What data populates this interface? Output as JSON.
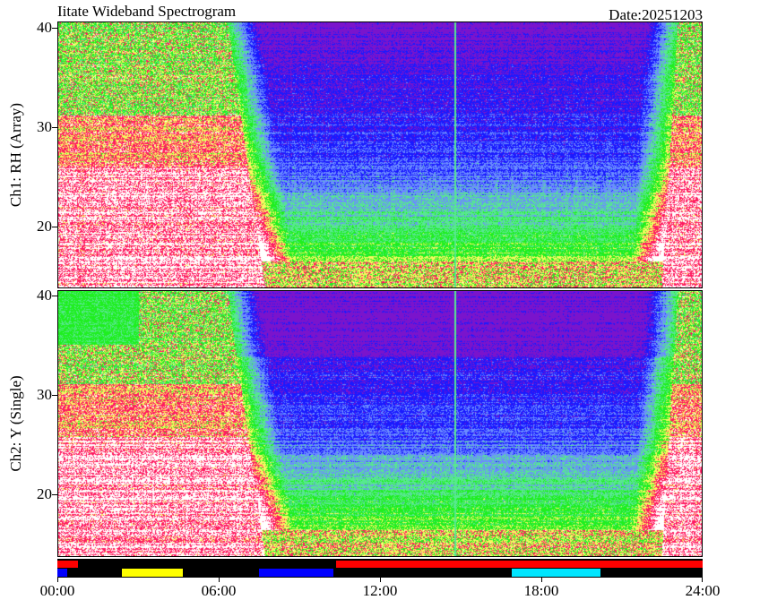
{
  "header": {
    "title": "Iitate Wideband Spectrogram",
    "date": "Date:20251203"
  },
  "chart_data": {
    "type": "heatmap",
    "panels": [
      {
        "ylabel": "Ch1: RH (Array)",
        "yticks": [
          "40",
          "30",
          "20"
        ],
        "ylim": [
          13.5,
          40.5
        ]
      },
      {
        "ylabel": "Ch2: Y (Single)",
        "yticks": [
          "40",
          "30",
          "20"
        ],
        "ylim": [
          13.5,
          40.5
        ]
      }
    ],
    "xticks": [
      "00:00",
      "06:00",
      "12:00",
      "18:00",
      "24:00"
    ],
    "xlim_hours": [
      0,
      24
    ],
    "colorscale": [
      "#ffffff",
      "#ff1a60",
      "#f7f760",
      "#1fef1f",
      "#57e890",
      "#6a8cff",
      "#1a1aff",
      "#7a14cc"
    ],
    "status_bars": [
      {
        "color": "#ff0000",
        "row": "top",
        "start_hour": 0.0,
        "end_hour": 0.75
      },
      {
        "color": "#ff0000",
        "row": "top",
        "start_hour": 10.35,
        "end_hour": 24.0
      },
      {
        "color": "#0000ff",
        "row": "bottom",
        "start_hour": 0.0,
        "end_hour": 0.35
      },
      {
        "color": "#ffff00",
        "row": "bottom",
        "start_hour": 2.4,
        "end_hour": 4.65
      },
      {
        "color": "#0000ff",
        "row": "bottom",
        "start_hour": 7.5,
        "end_hour": 10.25
      },
      {
        "color": "#00e5ff",
        "row": "bottom",
        "start_hour": 16.9,
        "end_hour": 20.2
      }
    ]
  }
}
